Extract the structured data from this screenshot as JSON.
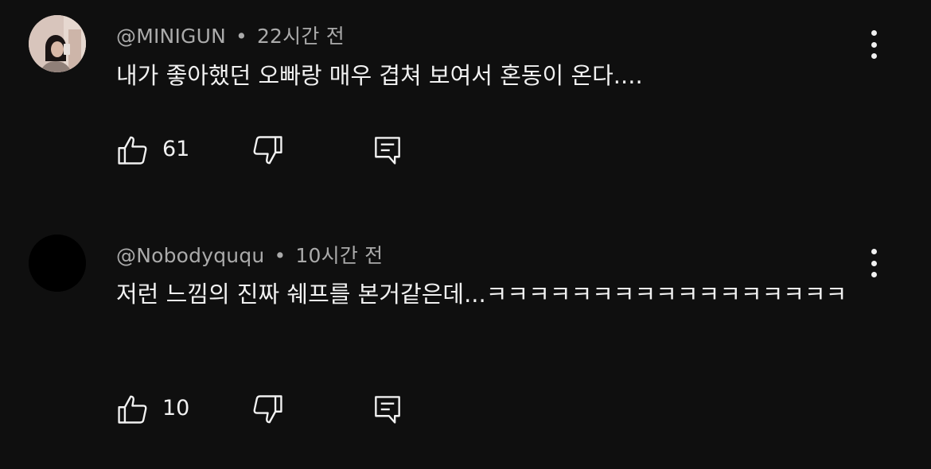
{
  "comments": [
    {
      "author": "@MINIGUN",
      "time": "22시간 전",
      "text": "내가 좋아했던 오빠랑 매우 겹쳐 보여서 혼동이 온다....",
      "likes": "61",
      "avatar_icon": "profile-photo"
    },
    {
      "author": "@Nobodyququ",
      "time": "10시간 전",
      "text": "저런 느낌의 진짜 쉐프를 본거같은데...ㅋㅋㅋㅋㅋㅋㅋㅋㅋㅋㅋㅋㅋㅋㅋㅋㅋ",
      "likes": "10",
      "avatar_icon": "blank-avatar"
    }
  ],
  "separator": "•",
  "icons": {
    "like": "thumbs-up-icon",
    "dislike": "thumbs-down-icon",
    "reply": "reply-icon",
    "more": "more-vert-icon"
  },
  "colors": {
    "background": "#0f0f0f",
    "primary_text": "#f1f1f1",
    "secondary_text": "#aaaaaa"
  }
}
